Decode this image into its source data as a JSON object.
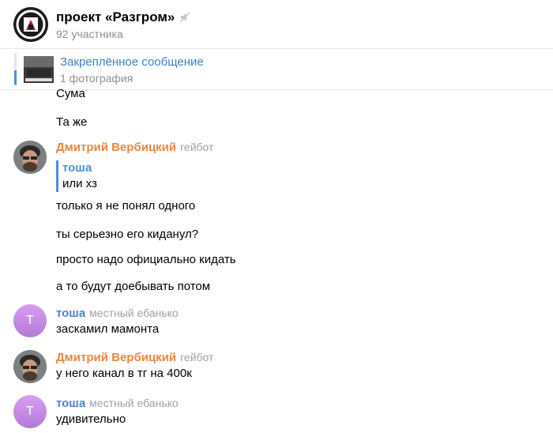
{
  "chat": {
    "title": "проект «Разгром»",
    "subtitle": "92 участника"
  },
  "pinned": {
    "title": "Закреплённое сообщение",
    "subtitle": "1 фотография"
  },
  "messages": {
    "m1": "Сума",
    "m2": "Та же",
    "group1": {
      "sender": "Дмитрий Вербицкий",
      "title": "гейбот",
      "reply_name": "тоша",
      "reply_text": "или хз",
      "lines": [
        "только я не понял одного",
        "ты серьезно его киданул?",
        "просто надо официально кидать",
        "а то будут доебывать потом"
      ]
    },
    "group2": {
      "avatar_letter": "Т",
      "sender": "тоша",
      "title": "местный ебанько",
      "text": "заскамил мамонта"
    },
    "group3": {
      "sender": "Дмитрий Вербицкий",
      "title": "гейбот",
      "text": "у него канал в тг на 400к"
    },
    "group4": {
      "avatar_letter": "Т",
      "sender": "тоша",
      "title": "местный ебанько",
      "text": "удивительно"
    }
  },
  "colors": {
    "sender_orange": "#e9873d",
    "sender_blue": "#4f7fd4",
    "link_blue": "#3b82c4",
    "muted_gray": "#8e8e93"
  }
}
